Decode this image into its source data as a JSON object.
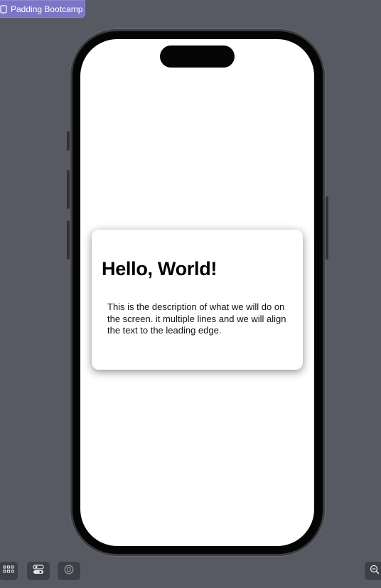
{
  "preview": {
    "label": "Padding Bootcamp",
    "icon": "document-icon"
  },
  "card": {
    "title": "Hello, World!",
    "description": "This is the description of what we will do on the screen. it multiple lines and we will align the text to the leading edge."
  },
  "canvas_controls": {
    "icons": [
      "grid-icon",
      "variants-icon",
      "selectable-mode-icon",
      "zoom-out-icon"
    ]
  },
  "colors": {
    "canvas_background": "#575a63",
    "preview_chip": "#7b76c6",
    "card_background": "#ffffff",
    "text": "#000000"
  }
}
